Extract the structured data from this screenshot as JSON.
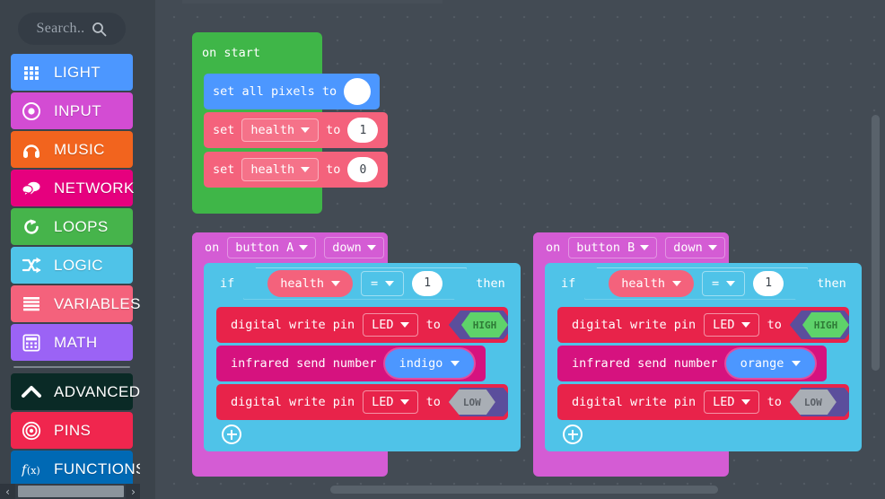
{
  "toolbox": {
    "search": {
      "placeholder": "Search..",
      "icon": "search-icon"
    },
    "categories": [
      {
        "label": "LIGHT",
        "color": "#4C97FF",
        "icon": "grid-icon"
      },
      {
        "label": "INPUT",
        "color": "#D34CD3",
        "icon": "target-dot-icon"
      },
      {
        "label": "MUSIC",
        "color": "#F2641E",
        "icon": "headphones-icon"
      },
      {
        "label": "NETWORK",
        "color": "#E6007E",
        "icon": "speech-bubbles-icon"
      },
      {
        "label": "LOOPS",
        "color": "#46B44B",
        "icon": "refresh-arrow-icon"
      },
      {
        "label": "LOGIC",
        "color": "#4FC3E8",
        "icon": "shuffle-icon"
      },
      {
        "label": "VARIABLES",
        "color": "#F4627C",
        "icon": "lines-icon"
      },
      {
        "label": "MATH",
        "color": "#9B63F5",
        "icon": "calculator-icon"
      }
    ],
    "advanced": [
      {
        "label": "ADVANCED",
        "color": "#0A2A26",
        "icon": "chevron-up-icon"
      },
      {
        "label": "PINS",
        "color": "#F0264E",
        "icon": "concentric-circles-icon"
      },
      {
        "label": "FUNCTIONS",
        "color": "#0069B4",
        "icon": "fx-icon"
      }
    ],
    "scroll": {
      "up": "⌃",
      "down": "⌄",
      "left": "‹",
      "right": "›"
    }
  },
  "workspace": {
    "blocks": {
      "on_start": {
        "label": "on start",
        "color": "#3FB648",
        "children": [
          {
            "id": "set_all_pixels",
            "text": "set all pixels to",
            "color": "#4C97FF",
            "swatch": "#FFFFFF"
          },
          {
            "id": "set_health_1",
            "prefix": "set",
            "variable": "health",
            "mid": "to",
            "value": "1",
            "color": "#F4627C"
          },
          {
            "id": "set_health_2",
            "prefix": "set",
            "variable": "health",
            "mid": "to",
            "value": "0",
            "color": "#F4627C"
          }
        ]
      },
      "on_button_a": {
        "prefix": "on",
        "button": "button A",
        "event": "down",
        "color": "#D45CD4",
        "condition": {
          "if_label": "if",
          "variable": "health",
          "operator": "=",
          "value": "1",
          "then_label": "then",
          "color": "#4FC3E8"
        },
        "statements": [
          {
            "id": "dw_high",
            "text": "digital write pin",
            "pin": "LED",
            "mid": "to",
            "value": "HIGH",
            "color": "#E8234A",
            "value_color": "#5ED36A"
          },
          {
            "id": "ir_send",
            "text": "infrared send number",
            "value": "indigo",
            "color": "#D6127F",
            "value_color": "#4C97FF"
          },
          {
            "id": "dw_low",
            "text": "digital write pin",
            "pin": "LED",
            "mid": "to",
            "value": "LOW",
            "color": "#E8234A",
            "value_color": "#A9AEB5"
          }
        ],
        "add_button": "plus-icon"
      },
      "on_button_b": {
        "prefix": "on",
        "button": "button B",
        "event": "down",
        "color": "#D45CD4",
        "condition": {
          "if_label": "if",
          "variable": "health",
          "operator": "=",
          "value": "1",
          "then_label": "then",
          "color": "#4FC3E8"
        },
        "statements": [
          {
            "id": "dw_high",
            "text": "digital write pin",
            "pin": "LED",
            "mid": "to",
            "value": "HIGH",
            "color": "#E8234A",
            "value_color": "#5ED36A"
          },
          {
            "id": "ir_send",
            "text": "infrared send number",
            "value": "orange",
            "color": "#D6127F",
            "value_color": "#4C97FF"
          },
          {
            "id": "dw_low",
            "text": "digital write pin",
            "pin": "LED",
            "mid": "to",
            "value": "LOW",
            "color": "#E8234A",
            "value_color": "#A9AEB5"
          }
        ],
        "add_button": "plus-icon"
      }
    }
  }
}
